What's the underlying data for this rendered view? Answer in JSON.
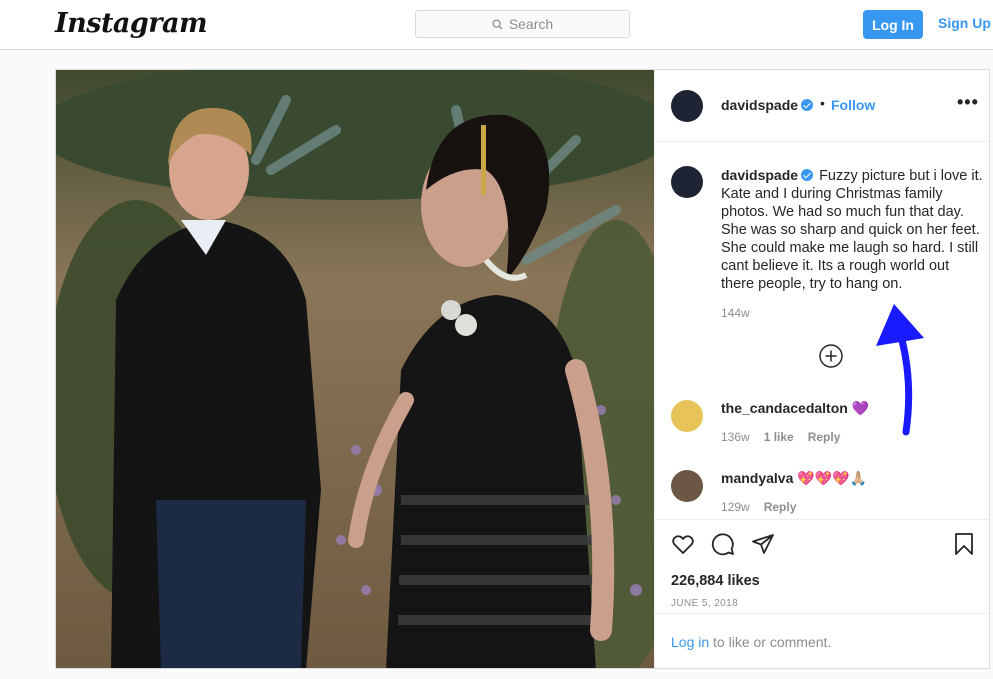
{
  "header": {
    "logo": "Instagram",
    "search_placeholder": "Search",
    "login_label": "Log In",
    "signup_label": "Sign Up"
  },
  "post": {
    "username": "davidspade",
    "separator": "•",
    "follow_label": "Follow",
    "more_label": "•••",
    "caption": "Fuzzy picture but i love it. Kate and I during Christmas family photos. We had so much fun that day. She was so sharp and quick on her feet. She could make me laugh so hard. I still cant believe it. Its a rough world out there people, try to hang on.",
    "caption_time": "144w",
    "comments": [
      {
        "username": "the_candacedalton",
        "text": "💜",
        "time": "136w",
        "likes": "1 like",
        "reply": "Reply"
      },
      {
        "username": "mandyalva",
        "text": "💖💖💖🙏🏼",
        "time": "129w",
        "reply": "Reply"
      }
    ],
    "likes": "226,884 likes",
    "date": "JUNE 5, 2018",
    "login_prompt_link": "Log in",
    "login_prompt_text": " to like or comment."
  },
  "colors": {
    "accent": "#3897f0",
    "annotation_arrow": "#1a1aff"
  }
}
